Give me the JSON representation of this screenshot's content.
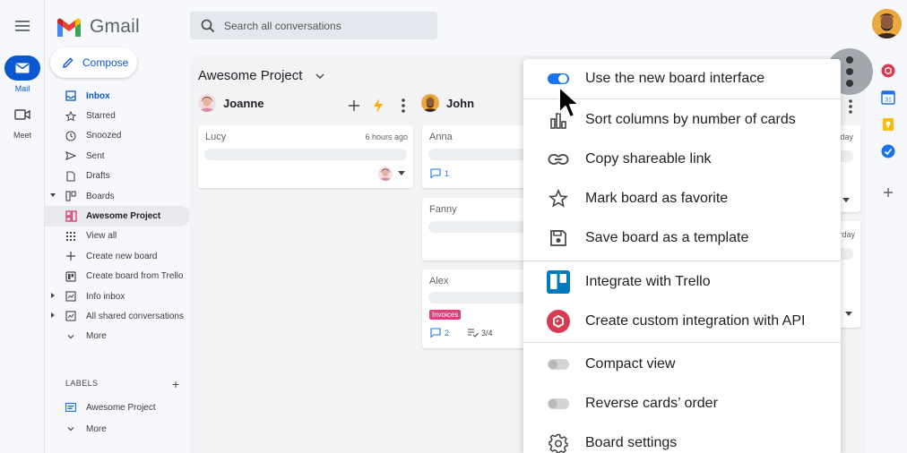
{
  "app": {
    "name": "Gmail"
  },
  "rail": {
    "mail_label": "Mail",
    "meet_label": "Meet"
  },
  "search": {
    "placeholder": "Search all conversations"
  },
  "compose": {
    "label": "Compose"
  },
  "nav": {
    "inbox": "Inbox",
    "starred": "Starred",
    "snoozed": "Snoozed",
    "sent": "Sent",
    "drafts": "Drafts",
    "boards": "Boards",
    "awesome_project": "Awesome Project",
    "view_all": "View all",
    "create_new_board": "Create new board",
    "create_from_trello": "Create board from Trello",
    "info_inbox": "Info inbox",
    "all_shared": "All shared conversations",
    "more": "More"
  },
  "labels": {
    "heading": "LABELS",
    "items": [
      "Awesome Project"
    ],
    "more": "More"
  },
  "board": {
    "title": "Awesome Project",
    "columns": [
      {
        "name": "Joanne",
        "cards": [
          {
            "title": "Lucy",
            "time": "6 hours ago"
          }
        ]
      },
      {
        "name": "John",
        "cards": [
          {
            "title": "Anna",
            "comments": "1"
          },
          {
            "title": "Fanny"
          },
          {
            "title": "Alex",
            "tag": "Invoices",
            "comments": "2",
            "tasks": "3/4"
          }
        ]
      }
    ],
    "partial_right": [
      "day",
      "rday"
    ]
  },
  "menu": {
    "items": [
      {
        "label": "Use the new board interface",
        "toggle": "on"
      },
      {
        "label": "Sort columns by number of cards"
      },
      {
        "label": "Copy shareable link"
      },
      {
        "label": "Mark board as favorite"
      },
      {
        "label": "Save board as a template"
      },
      {
        "label": "Integrate with Trello"
      },
      {
        "label": "Create custom integration with API"
      },
      {
        "label": "Compact view",
        "toggle": "off"
      },
      {
        "label": "Reverse cards’ order",
        "toggle": "off"
      },
      {
        "label": "Board settings"
      }
    ]
  },
  "colors": {
    "accent": "#0b57d0",
    "toggle_on": "#1a73e8",
    "trello": "#0079bf",
    "api": "#d93a52",
    "tag": "#d9417e",
    "lightning": "#f9ab00"
  }
}
